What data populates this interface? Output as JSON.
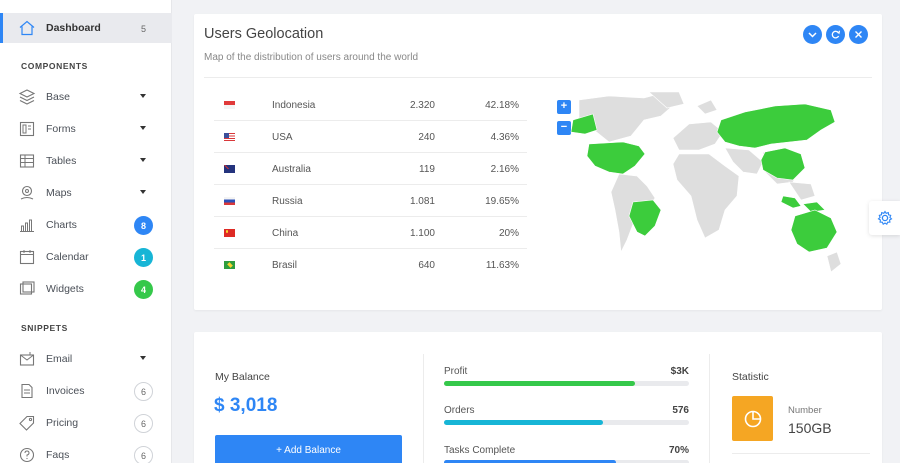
{
  "sidebar": {
    "dashboard": {
      "label": "Dashboard",
      "badge": "5"
    },
    "components_title": "COMPONENTS",
    "components": [
      {
        "label": "Base",
        "icon": "layers-icon"
      },
      {
        "label": "Forms",
        "icon": "form-icon"
      },
      {
        "label": "Tables",
        "icon": "table-icon"
      },
      {
        "label": "Maps",
        "icon": "map-pin-icon"
      },
      {
        "label": "Charts",
        "icon": "chart-icon",
        "badge": "8",
        "badge_color": "#2e86f5"
      },
      {
        "label": "Calendar",
        "icon": "calendar-icon",
        "badge": "1",
        "badge_color": "#17b5d6"
      },
      {
        "label": "Widgets",
        "icon": "widgets-icon",
        "badge": "4",
        "badge_color": "#35c84a"
      }
    ],
    "snippets_title": "SNIPPETS",
    "snippets": [
      {
        "label": "Email",
        "icon": "email-icon"
      },
      {
        "label": "Invoices",
        "icon": "invoice-icon",
        "badge": "6"
      },
      {
        "label": "Pricing",
        "icon": "tag-icon",
        "badge": "6"
      },
      {
        "label": "Faqs",
        "icon": "help-icon",
        "badge": "6"
      }
    ]
  },
  "geolocation": {
    "title": "Users Geolocation",
    "subtitle": "Map of the distribution of users around the world",
    "rows": [
      {
        "country": "Indonesia",
        "users": "2.320",
        "percent": "42.18%"
      },
      {
        "country": "USA",
        "users": "240",
        "percent": "4.36%"
      },
      {
        "country": "Australia",
        "users": "119",
        "percent": "2.16%"
      },
      {
        "country": "Russia",
        "users": "1.081",
        "percent": "19.65%"
      },
      {
        "country": "China",
        "users": "1.100",
        "percent": "20%"
      },
      {
        "country": "Brasil",
        "users": "640",
        "percent": "11.63%"
      }
    ],
    "zoom_in": "+",
    "zoom_out": "−",
    "map_highlight_color": "#3ccc3c",
    "map_base_color": "#dedede"
  },
  "balance": {
    "title": "My Balance",
    "amount": "$ 3,018",
    "button": "+ Add Balance"
  },
  "progress": [
    {
      "label": "Profit",
      "value": "$3K",
      "percent": 78,
      "color": "#35c84a"
    },
    {
      "label": "Orders",
      "value": "576",
      "percent": 65,
      "color": "#17b5d6"
    },
    {
      "label": "Tasks Complete",
      "value": "70%",
      "percent": 70,
      "color": "#2e86f5"
    }
  ],
  "statistic": {
    "title": "Statistic",
    "label": "Number",
    "value": "150GB",
    "icon_color": "#f5a623"
  }
}
